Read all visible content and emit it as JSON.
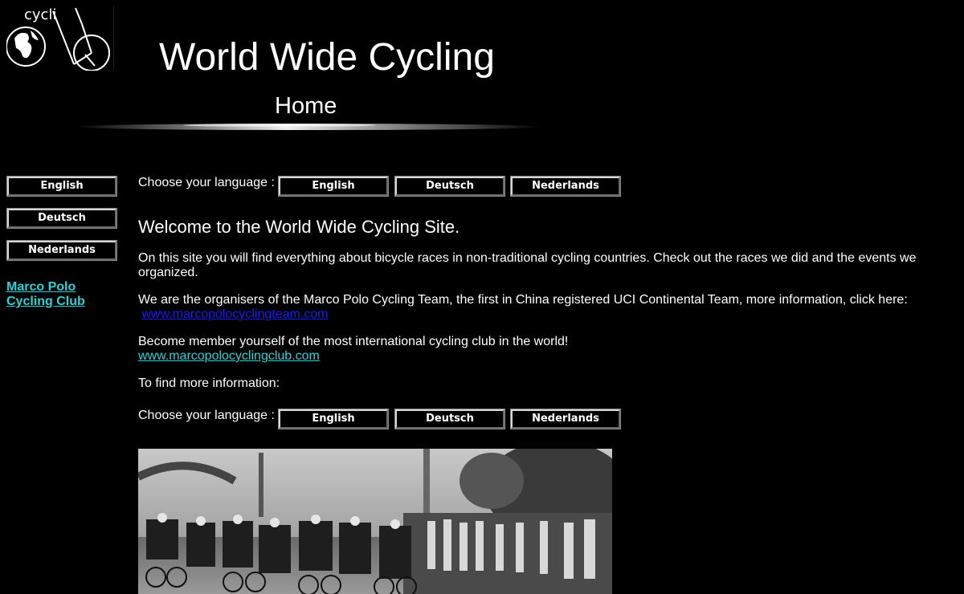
{
  "header": {
    "logo_text": "cycli",
    "site_title": "World Wide Cycling",
    "page_heading": "Home"
  },
  "sidebar": {
    "buttons": [
      {
        "label": "English"
      },
      {
        "label": "Deutsch"
      },
      {
        "label": "Nederlands"
      }
    ],
    "club_link": {
      "line1": "Marco Polo",
      "line2": "Cycling Club"
    }
  },
  "main": {
    "choose_language_label": "Choose your language :",
    "language_buttons": [
      "English",
      "Deutsch",
      "Nederlands"
    ],
    "welcome": "Welcome to the World Wide Cycling Site.",
    "paragraph1": "On this site you will find everything about bicycle races in non-traditional cycling countries. Check out the races we did and the events we organized.",
    "paragraph2": "We are the organisers of the Marco Polo Cycling Team, the first in China registered UCI Continental Team, more information, click here:",
    "team_link": "www.marcopolocyclingteam.com",
    "paragraph3": "Become member yourself of the most international cycling club in the world!",
    "club_link": "www.marcopolocyclingclub.com",
    "more_info": "To find more information:"
  },
  "colors": {
    "background": "#000000",
    "text": "#ffffff",
    "club_link": "#2fd0d6",
    "team_link": "#1a1aee"
  }
}
